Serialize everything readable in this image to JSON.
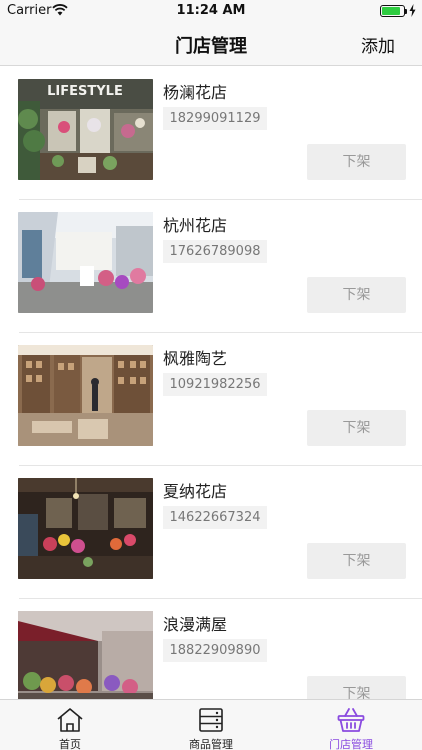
{
  "status": {
    "carrier": "Carrier",
    "time": "11:24 AM",
    "battery_level": 0.85
  },
  "nav": {
    "title": "门店管理",
    "action_label": "添加"
  },
  "stores": [
    {
      "name": "杨澜花店",
      "phone": "18299091129",
      "action": "下架"
    },
    {
      "name": "杭州花店",
      "phone": "17626789098",
      "action": "下架"
    },
    {
      "name": "枫雅陶艺",
      "phone": "10921982256",
      "action": "下架"
    },
    {
      "name": "夏纳花店",
      "phone": "14622667324",
      "action": "下架"
    },
    {
      "name": "浪漫满屋",
      "phone": "18822909890",
      "action": "下架"
    }
  ],
  "photo_text": {
    "shop_sign": "LIFESTYLE"
  },
  "tabs": [
    {
      "label": "首页",
      "icon": "home-icon",
      "active": false
    },
    {
      "label": "商品管理",
      "icon": "product-list-icon",
      "active": false
    },
    {
      "label": "门店管理",
      "icon": "basket-icon",
      "active": true
    }
  ],
  "colors": {
    "accent": "#8a4be0",
    "button_bg": "#eeeeee",
    "button_text": "#999999",
    "chip_bg": "#f2f2f2"
  }
}
